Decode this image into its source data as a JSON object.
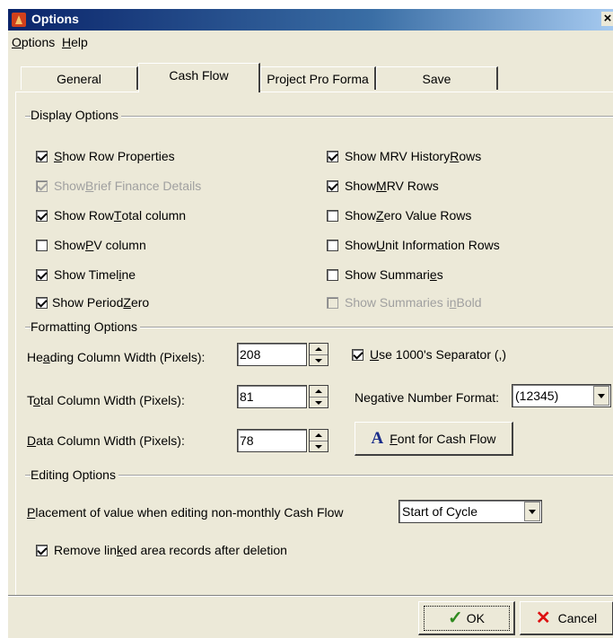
{
  "window": {
    "title": "Options",
    "close_glyph": "×"
  },
  "menubar": {
    "options": {
      "hot": "O",
      "rest": "ptions"
    },
    "help": {
      "hot": "H",
      "rest": "elp"
    }
  },
  "tabs": [
    {
      "label": "General",
      "active": false
    },
    {
      "label": "Cash Flow",
      "active": true
    },
    {
      "label": "Project Pro Forma",
      "active": false
    },
    {
      "label": "Save",
      "active": false
    }
  ],
  "display_options": {
    "heading": "Display Options",
    "left": [
      {
        "pre": "",
        "hot": "S",
        "post": "how Row Properties",
        "checked": true,
        "enabled": true
      },
      {
        "pre": "Show ",
        "hot": "B",
        "post": "rief Finance Details",
        "checked": true,
        "enabled": false
      },
      {
        "pre": "Show Row ",
        "hot": "T",
        "post": "otal column",
        "checked": true,
        "enabled": true
      },
      {
        "pre": "Show ",
        "hot": "P",
        "post": "V column",
        "checked": false,
        "enabled": true
      },
      {
        "pre": "Show Timel",
        "hot": "i",
        "post": "ne",
        "checked": true,
        "enabled": true
      },
      {
        "pre": "Show Period ",
        "hot": "Z",
        "post": "ero",
        "checked": true,
        "enabled": true
      }
    ],
    "right": [
      {
        "pre": "Show MRV History ",
        "hot": "R",
        "post": "ows",
        "checked": true,
        "enabled": true
      },
      {
        "pre": "Show ",
        "hot": "M",
        "post": "RV Rows",
        "checked": true,
        "enabled": true
      },
      {
        "pre": "Show ",
        "hot": "Z",
        "post": "ero Value Rows",
        "checked": false,
        "enabled": true
      },
      {
        "pre": "Show ",
        "hot": "U",
        "post": "nit Information Rows",
        "checked": false,
        "enabled": true
      },
      {
        "pre": "Show Summari",
        "hot": "e",
        "post": "s",
        "checked": false,
        "enabled": true
      },
      {
        "pre": "Show Summaries i",
        "hot": "n",
        "post": " Bold",
        "checked": false,
        "enabled": false
      }
    ]
  },
  "formatting_options": {
    "heading": "Formatting Options",
    "heading_width": {
      "pre": "He",
      "hot": "a",
      "post": "ding Column Width (Pixels):",
      "value": "208"
    },
    "total_width": {
      "pre": "T",
      "hot": "o",
      "post": "tal Column Width (Pixels):",
      "value": "81"
    },
    "data_width": {
      "pre": "",
      "hot": "D",
      "post": "ata Column Width (Pixels):",
      "value": "78"
    },
    "separator": {
      "pre": "",
      "hot": "U",
      "post": "se 1000's Separator (,)",
      "checked": true
    },
    "negative_format": {
      "label": "Negative Number Format:",
      "value": "(12345)"
    },
    "font_button": {
      "glyph": "A",
      "hot": "F",
      "post": "ont for Cash Flow"
    }
  },
  "editing_options": {
    "heading": "Editing Options",
    "placement": {
      "hot": "P",
      "post": "lacement of value when editing non-monthly Cash Flow",
      "value": "Start of Cycle"
    },
    "remove_linked": {
      "pre": "Remove lin",
      "hot": "k",
      "post": "ed area records after deletion",
      "checked": true
    }
  },
  "buttons": {
    "ok": {
      "glyph": "✓",
      "label": "OK"
    },
    "cancel": {
      "glyph": "✕",
      "label": "Cancel"
    }
  }
}
